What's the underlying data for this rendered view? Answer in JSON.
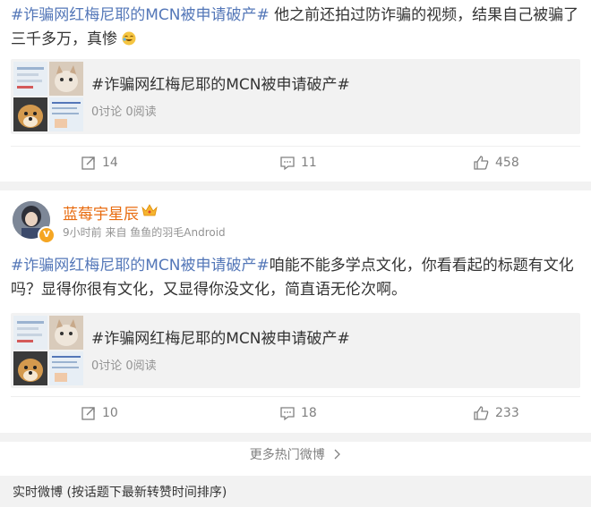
{
  "post1": {
    "text_tag": "#诈骗网红梅尼耶的MCN被申请破产#",
    "text_body": " 他之前还拍过防诈骗的视频，结果自己被骗了三千多万，真惨",
    "emoji_icon": "laugh-cry-emoji-icon",
    "card": {
      "title": "#诈骗网红梅尼耶的MCN被申请破产#",
      "meta": "0讨论 0阅读"
    },
    "actions": {
      "repost": "14",
      "comment": "11",
      "like": "458"
    }
  },
  "post2": {
    "username": "蓝莓宇星辰",
    "verified_badge": "V",
    "meta": "9小时前 来自 鱼鱼的羽毛Android",
    "text_tag": "#诈骗网红梅尼耶的MCN被申请破产#",
    "text_body": "咱能不能多学点文化，你看看起的标题有文化吗？显得你很有文化，又显得你没文化，简直语无伦次啊。",
    "card": {
      "title": "#诈骗网红梅尼耶的MCN被申请破产#",
      "meta": "0讨论 0阅读"
    },
    "actions": {
      "repost": "10",
      "comment": "18",
      "like": "233"
    }
  },
  "more_hot": "更多热门微博",
  "realtime_header": "实时微博 (按话题下最新转赞时间排序)",
  "colors": {
    "link": "#5477b8",
    "username": "#e86b0f",
    "muted": "#939393",
    "panel": "#f2f2f2"
  }
}
